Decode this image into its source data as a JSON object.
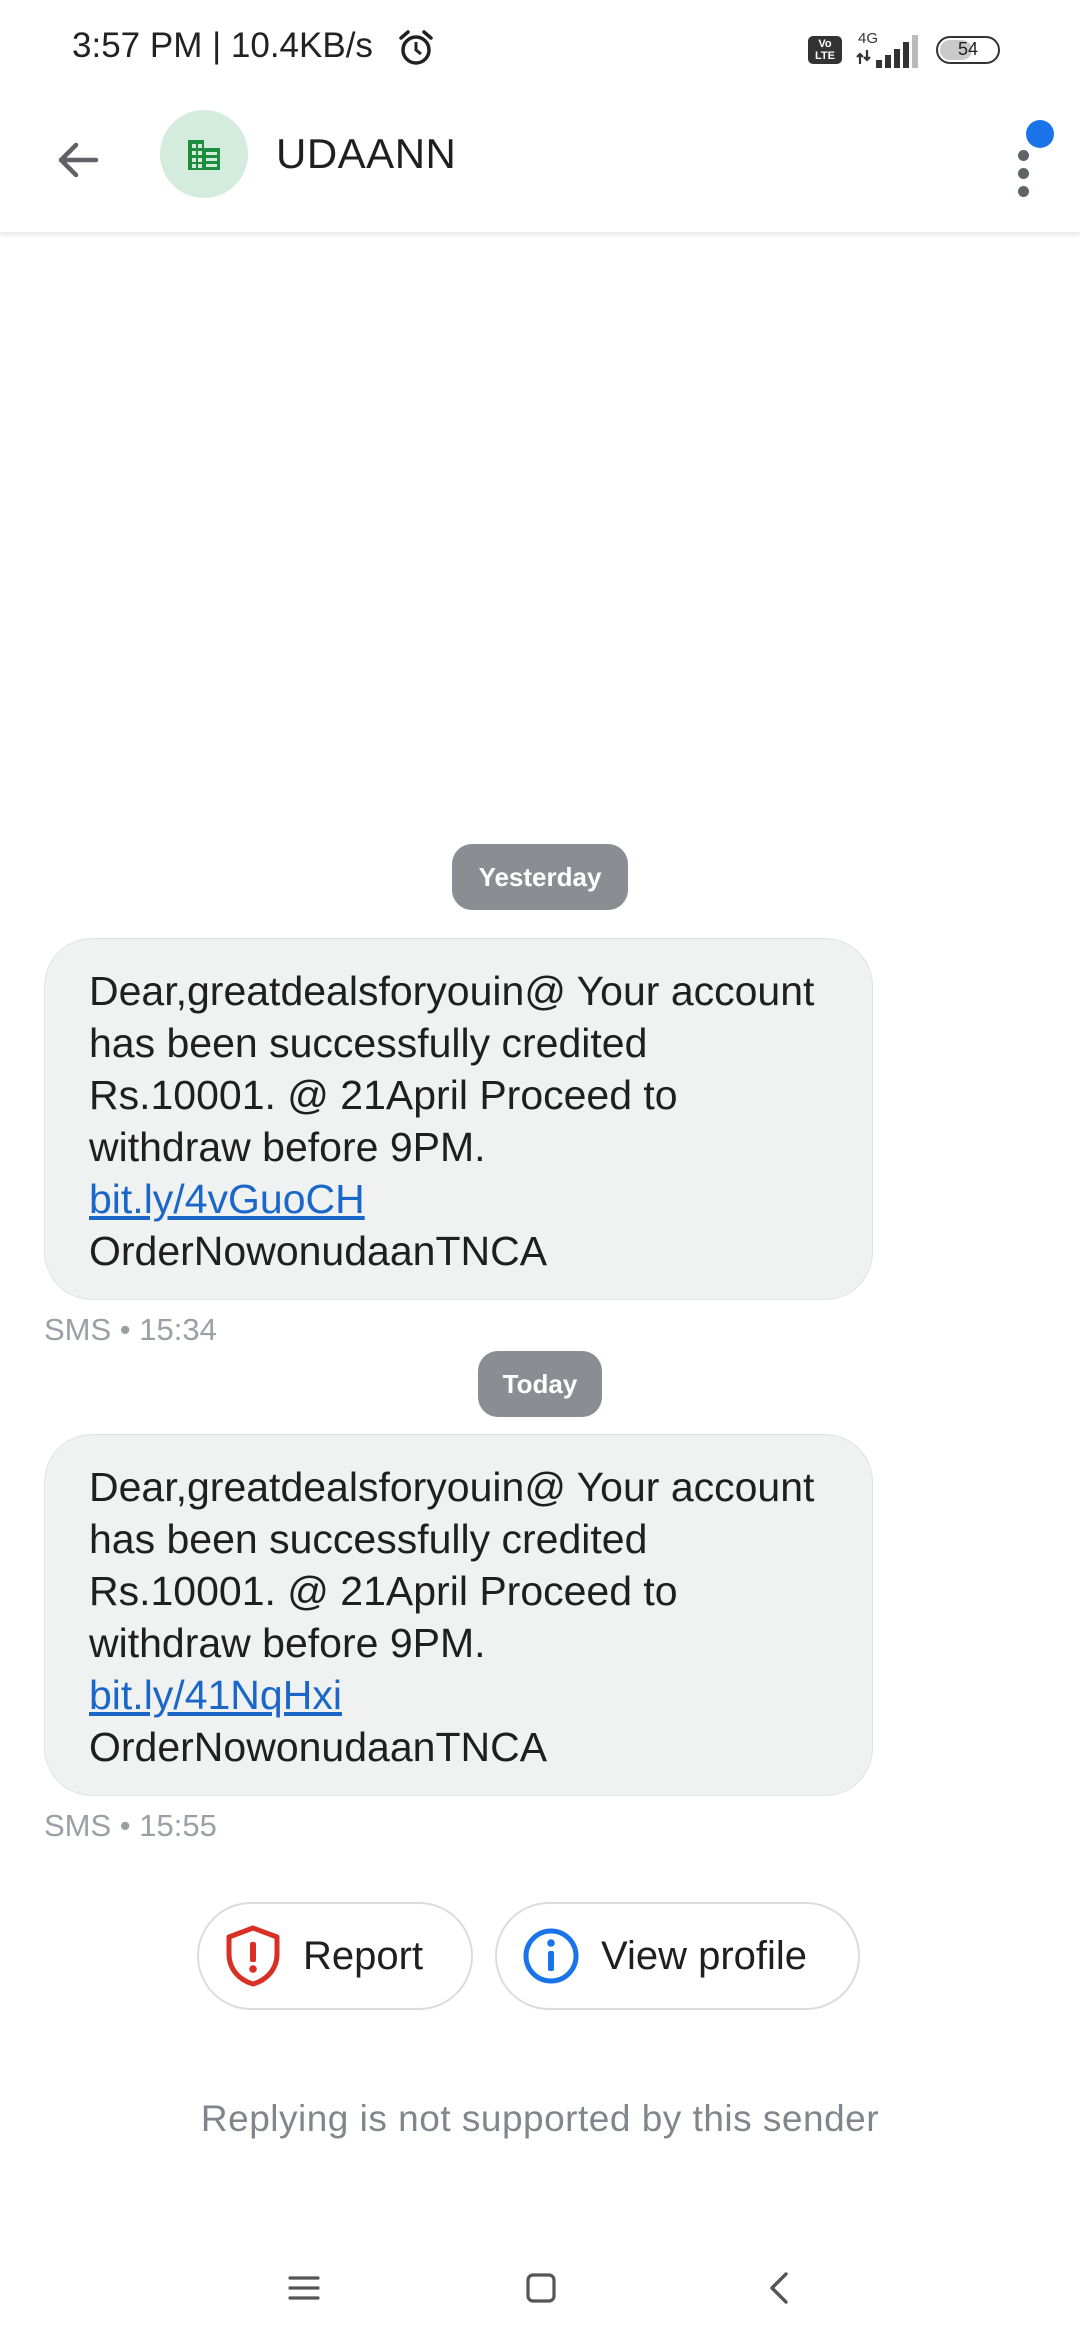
{
  "status_bar": {
    "time": "3:57 PM | 10.4KB/s",
    "network": "4G",
    "volte": "Vo LTE",
    "battery": "54",
    "icons": [
      "alarm-icon",
      "volte-icon",
      "signal-icon",
      "battery-icon"
    ]
  },
  "header": {
    "sender": "UDAANN",
    "avatar_icon": "business-icon",
    "back_icon": "arrow-back-icon",
    "menu_icon": "more-vert-icon",
    "colors": {
      "avatar_bg": "#d4ecdd",
      "avatar_icon": "#1e8e3e",
      "notification_dot": "#1a73e8"
    }
  },
  "conversation": {
    "groups": [
      {
        "date": "Yesterday",
        "message": {
          "text_before": "Dear,greatdealsforyouin@ Your account has been successfully credited Rs.10001. @ 21April Proceed to withdraw before 9PM.",
          "link": "bit.ly/4vGuoCH",
          "text_after": "OrderNowonudaanTNCA",
          "meta": "SMS • 15:34"
        }
      },
      {
        "date": "Today",
        "message": {
          "text_before": "Dear,greatdealsforyouin@ Your account has been successfully credited Rs.10001. @ 21April Proceed to withdraw before 9PM.",
          "link": "bit.ly/41NqHxi",
          "text_after": "OrderNowonudaanTNCA",
          "meta": "SMS • 15:55"
        }
      }
    ]
  },
  "actions": {
    "report_label": "Report",
    "report_icon": "shield-alert-icon",
    "view_profile_label": "View profile",
    "view_profile_icon": "info-icon",
    "colors": {
      "report": "#d93025",
      "info": "#1a73e8"
    }
  },
  "footer": {
    "reply_note": "Replying is not supported by this sender"
  },
  "nav": {
    "icons": [
      "recents-icon",
      "home-icon",
      "back-icon"
    ]
  }
}
